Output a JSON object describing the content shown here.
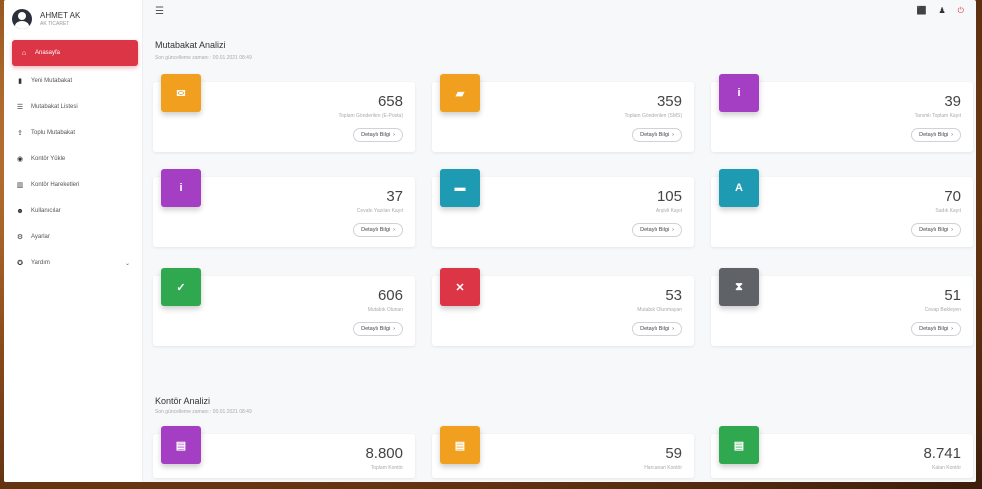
{
  "user": {
    "name": "AHMET AK",
    "company": "AK TİCARET"
  },
  "sidebar": {
    "items": [
      {
        "label": "Anasayfa",
        "icon": "home-icon",
        "glyph": "⌂",
        "active": true
      },
      {
        "label": "Yeni Mutabakat",
        "icon": "file-icon",
        "glyph": "▮"
      },
      {
        "label": "Mutabakat Listesi",
        "icon": "list-icon",
        "glyph": "☰"
      },
      {
        "label": "Toplu Mutabakat",
        "icon": "upload-icon",
        "glyph": "⇪"
      },
      {
        "label": "Kontör Yükle",
        "icon": "coins-icon",
        "glyph": "◉"
      },
      {
        "label": "Kontör Hareketleri",
        "icon": "chart-icon",
        "glyph": "▥"
      },
      {
        "label": "Kullanıcılar",
        "icon": "users-icon",
        "glyph": "☻"
      },
      {
        "label": "Ayarlar",
        "icon": "gear-icon",
        "glyph": "⚙"
      },
      {
        "label": "Yardım",
        "icon": "help-icon",
        "glyph": "✪",
        "expandable": true
      }
    ]
  },
  "topbar": {
    "menu_icon": "☰",
    "icons": [
      "⬛",
      "♟",
      "⏻"
    ]
  },
  "mutabakat": {
    "title": "Mutabakat Analizi",
    "updated": "Son güncelleme zamanı : 00.01.2021 08:49",
    "cards": [
      {
        "value": "658",
        "label": "Toplam Gönderilen (E-Posta)",
        "color": "#f0a01e",
        "glyph": "✉",
        "icon": "envelope-icon"
      },
      {
        "value": "359",
        "label": "Toplam Gönderilen (SMS)",
        "color": "#f0a01e",
        "glyph": "▰",
        "icon": "sms-icon"
      },
      {
        "value": "39",
        "label": "Tanımlı Toplam Kayıt",
        "color": "#a43fc4",
        "glyph": "i",
        "icon": "info-icon"
      },
      {
        "value": "37",
        "label": "Cevabı Yazılan Kayıt",
        "color": "#a43fc4",
        "glyph": "i",
        "icon": "info-icon"
      },
      {
        "value": "105",
        "label": "Arşivli Kayıt",
        "color": "#1e9bb3",
        "glyph": "▬",
        "icon": "archive-icon"
      },
      {
        "value": "70",
        "label": "Sadık Kayıt",
        "color": "#1e9bb3",
        "glyph": "A",
        "icon": "letter-a-icon"
      },
      {
        "value": "606",
        "label": "Mutabık Olunan",
        "color": "#2fa84f",
        "glyph": "✓",
        "icon": "check-icon"
      },
      {
        "value": "53",
        "label": "Mutabık Olunmayan",
        "color": "#dc3545",
        "glyph": "✕",
        "icon": "x-icon"
      },
      {
        "value": "51",
        "label": "Cevap Bekleyen",
        "color": "#5f6368",
        "glyph": "⧗",
        "icon": "hourglass-icon"
      }
    ],
    "button_label": "Detaylı Bilgi"
  },
  "kontor": {
    "title": "Kontör Analizi",
    "updated": "Son güncelleme zamanı : 00.01.2021 08:49",
    "cards": [
      {
        "value": "8.800",
        "label": "Toplam Kontör",
        "color": "#a43fc4",
        "glyph": "▤",
        "icon": "coins-icon"
      },
      {
        "value": "59",
        "label": "Harcanan Kontör",
        "color": "#f0a01e",
        "glyph": "▤",
        "icon": "coins-icon"
      },
      {
        "value": "8.741",
        "label": "Kalan Kontör",
        "color": "#2fa84f",
        "glyph": "▤",
        "icon": "coins-icon"
      }
    ]
  }
}
